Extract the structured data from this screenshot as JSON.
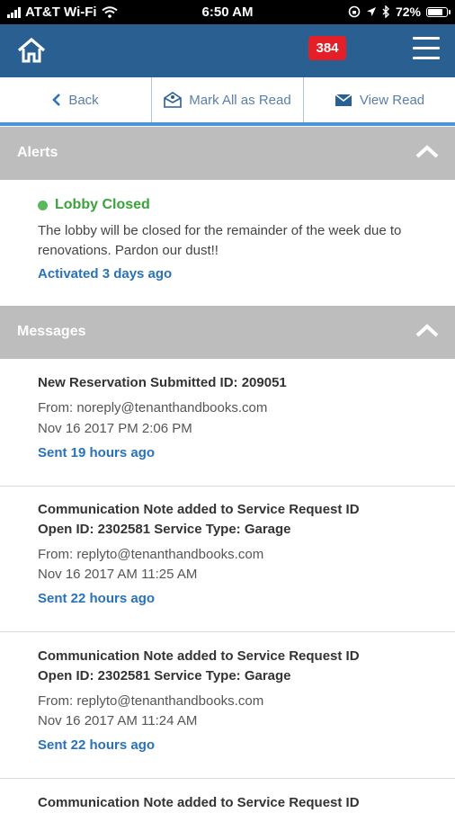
{
  "status_bar": {
    "carrier": "AT&T Wi-Fi",
    "time": "6:50 AM",
    "battery": "72%"
  },
  "header": {
    "badge_count": "384"
  },
  "toolbar": {
    "back_label": "Back",
    "mark_read_label": "Mark All as Read",
    "view_read_label": "View Read"
  },
  "alerts": {
    "title": "Alerts",
    "item": {
      "title": "Lobby Closed",
      "body": "The lobby will be closed for the remainder of the week due to renovations. Pardon our dust!!",
      "activated": "Activated 3 days ago",
      "status_color": "#5cb85c"
    }
  },
  "messages": {
    "title": "Messages",
    "items": [
      {
        "subject_line1": "New Reservation Submitted ID: 209051",
        "subject_line2": "",
        "from": "From: noreply@tenanthandbooks.com",
        "date": "Nov 16 2017 PM 2:06 PM",
        "sent": "Sent 19 hours ago"
      },
      {
        "subject_line1": "Communication Note added to Service Request ID",
        "subject_line2": "Open ID: 2302581 Service Type: Garage",
        "from": "From: replyto@tenanthandbooks.com",
        "date": "Nov 16 2017 AM 11:25 AM",
        "sent": "Sent 22 hours ago"
      },
      {
        "subject_line1": "Communication Note added to Service Request ID",
        "subject_line2": "Open ID: 2302581 Service Type: Garage",
        "from": "From: replyto@tenanthandbooks.com",
        "date": "Nov 16 2017 AM 11:24 AM",
        "sent": "Sent 22 hours ago"
      },
      {
        "subject_line1": "Communication Note added to Service Request ID"
      }
    ]
  },
  "colors": {
    "header_bg": "#2a5f91",
    "badge_bg": "#e32027",
    "accent": "#4a96d6",
    "link": "#2a72b8",
    "section_bg": "#bdbdbd"
  }
}
